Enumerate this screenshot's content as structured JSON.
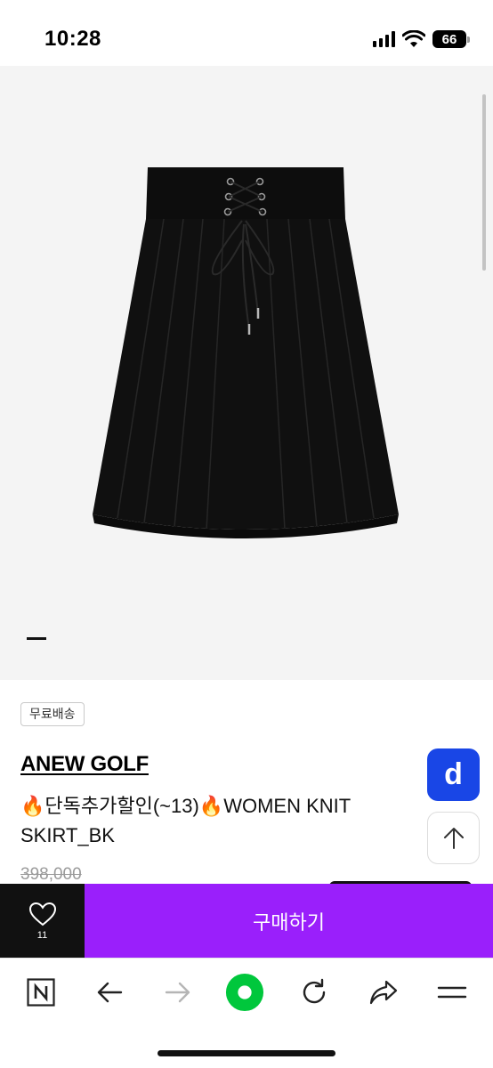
{
  "status_bar": {
    "time": "10:28",
    "battery": "66",
    "icons": [
      "signal-icon",
      "wifi-icon",
      "battery-icon"
    ]
  },
  "product": {
    "image": "black-pleated-knit-skirt",
    "carousel_position": 1,
    "shipping_badge": "무료배송",
    "brand": "ANEW GOLF",
    "title": "🔥단독추가할인(~13)🔥WOMEN KNIT SKIRT_BK",
    "original_price": "398,000"
  },
  "floating": {
    "d_button_label": "d",
    "scroll_top_icon": "arrow-up-icon"
  },
  "purchase_bar": {
    "like_count": "11",
    "like_icon": "heart-icon",
    "buy_label": "구매하기"
  },
  "browser_toolbar": {
    "items": [
      "naver-n-icon",
      "back-arrow-icon",
      "forward-arrow-icon",
      "green-dot-home-icon",
      "refresh-icon",
      "share-icon",
      "menu-icon"
    ]
  },
  "colors": {
    "buy_button": "#9a1ffb",
    "like_box": "#111111",
    "d_button": "#1946e6",
    "home_green": "#00c73c"
  }
}
